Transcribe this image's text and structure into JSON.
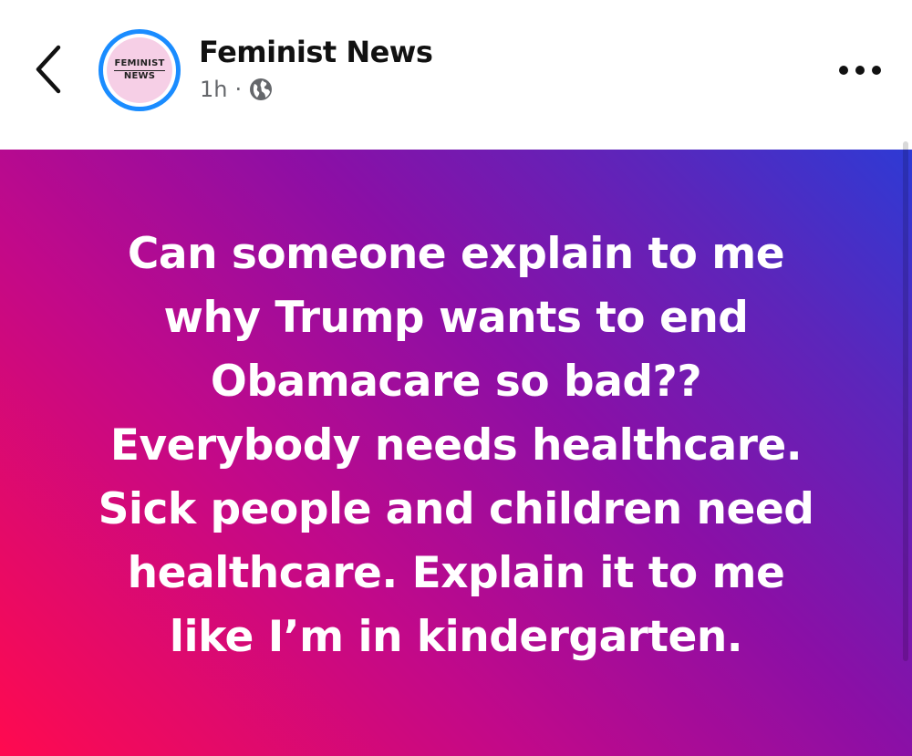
{
  "header": {
    "back_icon": "chevron-left-icon",
    "avatar": {
      "line1": "FEMINIST",
      "line2": "NEWS",
      "ring_color": "#1a8cff",
      "fill_color": "#f6cfe6"
    },
    "page_name": "Feminist News",
    "time": "1h",
    "separator": "·",
    "audience_icon": "globe-icon",
    "more_icon": "more-dots-icon"
  },
  "post": {
    "lines": [
      "Can someone explain to me",
      "why Trump wants to end",
      "Obamacare so bad??",
      "Everybody needs healthcare.",
      "Sick people and children need",
      "healthcare. Explain it to me",
      "like I’m in kindergarten."
    ],
    "text_color": "#ffffff",
    "gradient": [
      "#ff0a4f",
      "#8b0fa6",
      "#2e3ad4"
    ]
  }
}
